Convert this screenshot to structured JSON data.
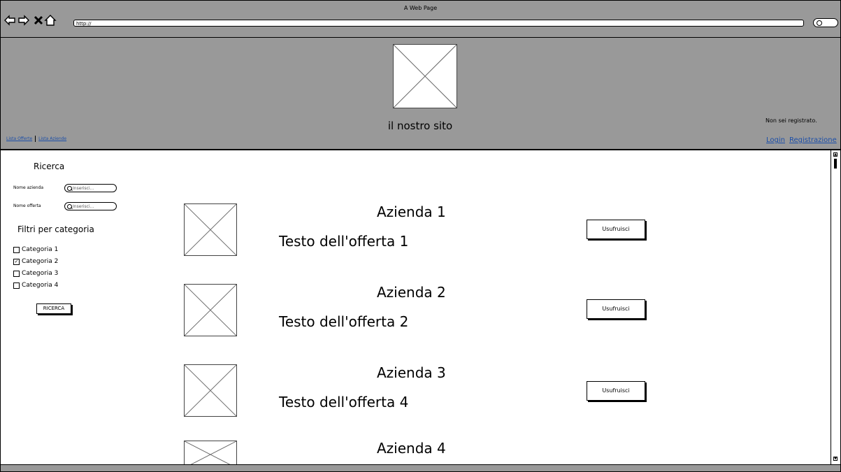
{
  "browser": {
    "window_title": "A Web Page",
    "url": "http://",
    "nav_icons": [
      "back-arrow-icon",
      "forward-arrow-icon",
      "close-icon",
      "home-icon"
    ]
  },
  "header": {
    "site_title": "il nostro sito",
    "nav_links": [
      "Lista Offerte",
      "Lista Aziende"
    ],
    "not_registered": "Non sei registrato.",
    "login": "Login",
    "register": "Registrazione"
  },
  "sidebar": {
    "title": "Ricerca",
    "fields": [
      {
        "label": "Nome azienda",
        "placeholder": "Inserisci..."
      },
      {
        "label": "Nome offerta",
        "placeholder": "Inserisci..."
      }
    ],
    "filters_title": "Filtri per categoria",
    "categories": [
      {
        "label": "Categoria 1",
        "checked": false
      },
      {
        "label": "Categoria 2",
        "checked": true
      },
      {
        "label": "Categoria 3",
        "checked": false
      },
      {
        "label": "Categoria 4",
        "checked": false
      }
    ],
    "search_button": "RICERCA"
  },
  "offers": [
    {
      "company": "Azienda 1",
      "text": "Testo dell'offerta 1",
      "button": "Usufruisci"
    },
    {
      "company": "Azienda 2",
      "text": "Testo dell'offerta 2",
      "button": "Usufruisci"
    },
    {
      "company": "Azienda 3",
      "text": "Testo dell'offerta 4",
      "button": "Usufruisci"
    },
    {
      "company": "Azienda 4",
      "text": "",
      "button": ""
    }
  ]
}
